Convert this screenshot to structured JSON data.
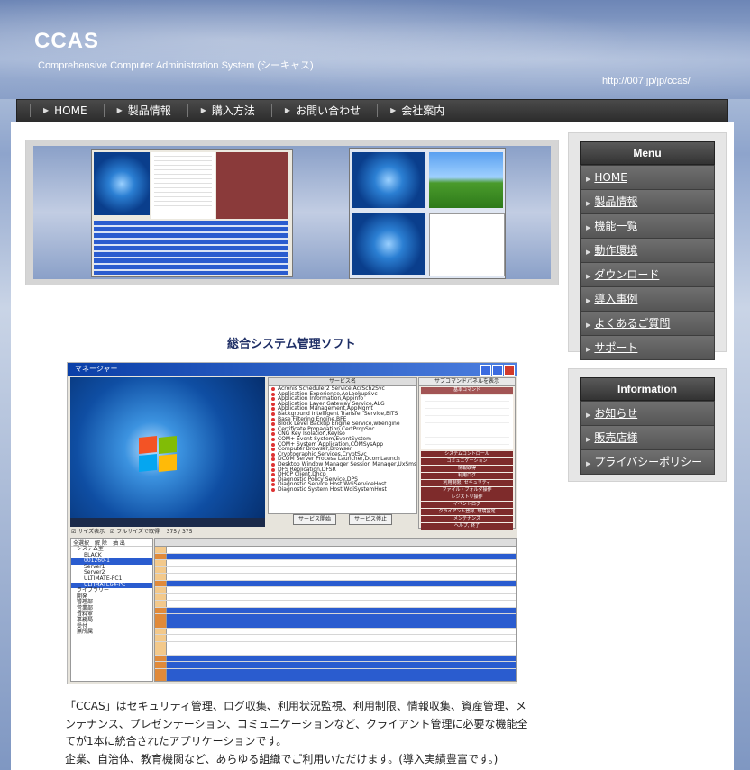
{
  "header": {
    "logo": "CCAS",
    "tagline": "Comprehensive Computer Administration System (シーキャス)",
    "url": "http://007.jp/jp/ccas/"
  },
  "nav": {
    "items": [
      {
        "label": "HOME"
      },
      {
        "label": "製品情報"
      },
      {
        "label": "購入方法"
      },
      {
        "label": "お問い合わせ"
      },
      {
        "label": "会社案内"
      }
    ]
  },
  "main": {
    "title": "総合システム管理ソフト",
    "app_window_title": "マネージャー",
    "app_checkbox_resize": "サイズ表示",
    "app_checkbox_fullsize": "フルサイズで取得",
    "app_count": "375 / 375",
    "app_cmd_header": "サブコマンドパネルを表示",
    "app_svc_header": "サービス名",
    "app_svc_start": "サービス開始",
    "app_svc_stop": "サービス停止",
    "app_cmd_buttons": [
      "基本コマンド",
      "システムコントロール",
      "コミュニケーション",
      "情報取得",
      "利用ログ",
      "利用制限, セキュリティ",
      "ファイル・フォルダ操作",
      "レジストリ操作",
      "イベントログ",
      "クライアント登録, 環境設定",
      "メンテナンス",
      "ヘルプ, 終了"
    ],
    "app_tree_buttons": [
      "全選択",
      "解 除",
      "抽 出"
    ],
    "app_tree": [
      "システム室",
      "BLACK",
      "001260-1",
      "Server1",
      "Server2",
      "ULTIMATE-PC1",
      "ULTIMATE64-PC",
      "ライブラリー",
      "開発",
      "管理部",
      "営業部",
      "資料室",
      "事務局",
      "受付",
      "無所属"
    ],
    "description": [
      "「CCAS」はセキュリティ管理、ログ収集、利用状況監視、利用制限、情報収集、資産管理、メンテナンス、プレゼンテーション、コミュニケーションなど、クライアント管理に必要な機能全てが1本に統合されたアプリケーションです。",
      "企業、自治体、教育機関など、あらゆる組織でご利用いただけます。(導入実績豊富です。)"
    ]
  },
  "sidebar": {
    "menu": {
      "title": "Menu",
      "items": [
        {
          "label": "HOME"
        },
        {
          "label": "製品情報"
        },
        {
          "label": "機能一覧"
        },
        {
          "label": "動作環境"
        },
        {
          "label": "ダウンロード"
        },
        {
          "label": "導入事例"
        },
        {
          "label": "よくあるご質問"
        },
        {
          "label": "サポート"
        }
      ]
    },
    "info": {
      "title": "Information",
      "items": [
        {
          "label": "お知らせ"
        },
        {
          "label": "販売店様"
        },
        {
          "label": "プライバシーポリシー"
        }
      ]
    }
  },
  "colors": {
    "nav_bg": "#333333",
    "accent": "#2a5ccf",
    "title": "#1f2f66"
  }
}
